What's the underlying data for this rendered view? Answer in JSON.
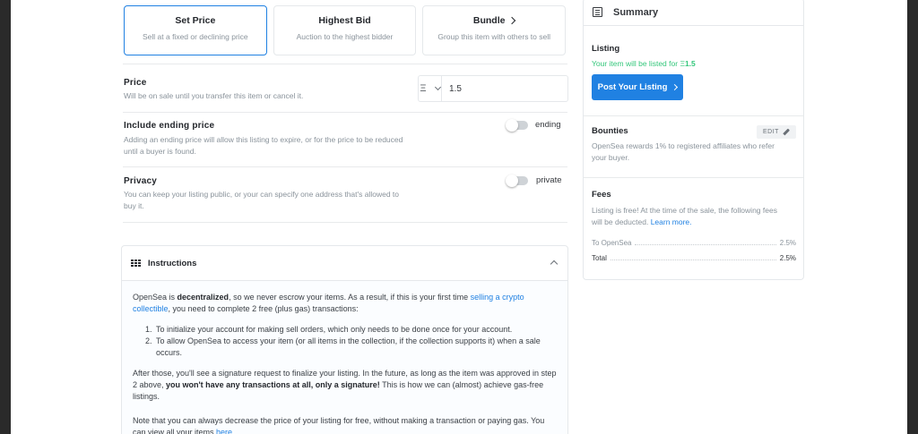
{
  "sale_types": [
    {
      "title": "Set Price",
      "desc": "Sell at a fixed or declining price",
      "selected": true
    },
    {
      "title": "Highest Bid",
      "desc": "Auction to the highest bidder",
      "selected": false
    },
    {
      "title": "Bundle",
      "desc": "Group this item with others to sell",
      "selected": false,
      "icon": "chevron-right-icon"
    }
  ],
  "price": {
    "title": "Price",
    "desc": "Will be on sale until you transfer this item or cancel it.",
    "currency_symbol": "Ξ",
    "value": "1.5"
  },
  "ending_price": {
    "title": "Include ending price",
    "desc_line1": "Adding an ending price will allow this listing to expire, or for the price to be reduced",
    "desc_line2": "until a buyer is found.",
    "toggle_label": "ending",
    "enabled": false
  },
  "privacy": {
    "title": "Privacy",
    "desc_line1": "You can keep your listing public, or your can specify one address that's allowed to",
    "desc_line2": "buy it.",
    "toggle_label": "private",
    "enabled": false
  },
  "instructions": {
    "title": "Instructions",
    "p1_a": "OpenSea is ",
    "p1_b": "decentralized",
    "p1_c": ", so we never escrow your items. As a result, if this is your first time ",
    "p1_link": "selling a crypto collectible",
    "p1_d": ", you need to complete 2 free (plus gas) transactions:",
    "steps": [
      "To initialize your account for making sell orders, which only needs to be done once for your account.",
      "To allow OpenSea to access your item (or all items in the collection, if the collection supports it) when a sale occurs."
    ],
    "p2_a": "After those, you'll see a signature request to finalize your listing. In the future, as long as the item was approved in step 2 above, ",
    "p2_b": "you won't have any transactions at all, only a signature!",
    "p2_c": " This is how we can (almost) achieve gas-free listings.",
    "p3_a": "Note that you can always decrease the price of your listing for free, without making a transaction or paying gas. You can view all your items ",
    "p3_link": "here",
    "p3_b": "."
  },
  "summary": {
    "title": "Summary",
    "listing": {
      "title": "Listing",
      "text": "Your item will be listed for ",
      "symbol": "Ξ",
      "amount": "1.5",
      "button_label": "Post Your Listing"
    },
    "bounties": {
      "title": "Bounties",
      "edit_label": "EDIT",
      "desc_line1": "OpenSea rewards 1% to registered affiliates who refer",
      "desc_line2": "your buyer."
    },
    "fees": {
      "title": "Fees",
      "desc_line1": "Listing is free! At the time of the sale, the following fees",
      "desc_line2": "will be deducted. ",
      "learn_more": "Learn more.",
      "rows": [
        {
          "label": "To OpenSea",
          "value": "2.5%"
        },
        {
          "label": "Total",
          "value": "2.5%"
        }
      ]
    }
  },
  "colors": {
    "accent": "#2081e2",
    "success": "#34c77b"
  }
}
